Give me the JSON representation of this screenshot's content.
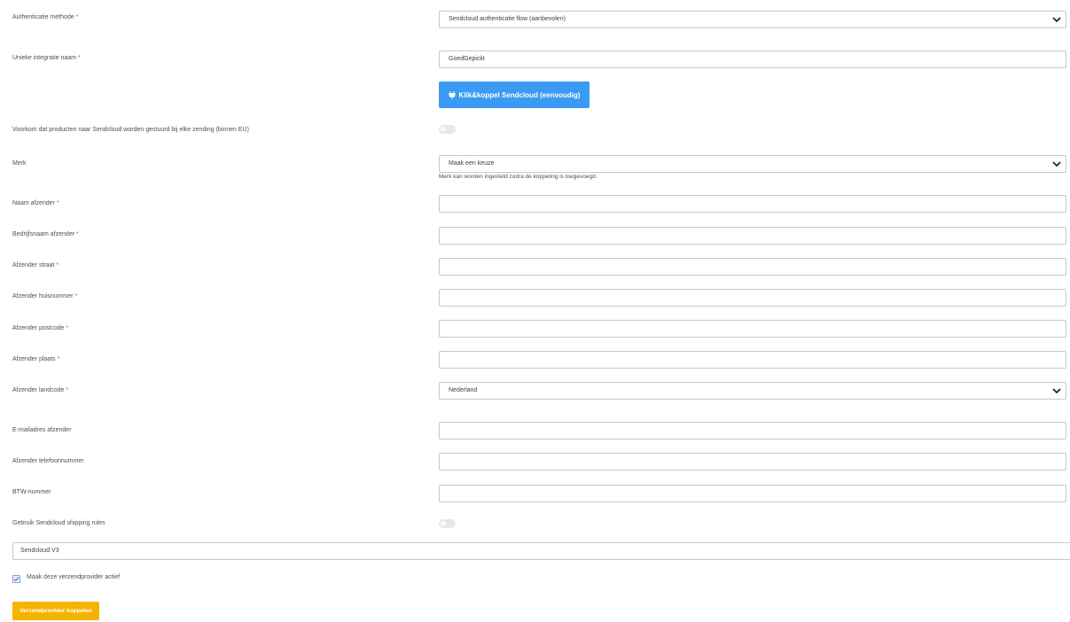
{
  "form": {
    "auth_method": {
      "label": "Authenticatie methode",
      "required": "*",
      "value": "Sendcloud authenticatie flow (aanbevolen)"
    },
    "integration_name": {
      "label": "Unieke integratie naam",
      "required": "*",
      "value": "GoedGepickt"
    },
    "connect_button": {
      "label": "Klik&koppel Sendcloud (eenvoudig)",
      "icon": "plug-icon"
    },
    "customs_toggle": {
      "label": "Voorkom dat producten naar Sendcloud worden gestuurd bij elke zending (binnen EU)",
      "on": false
    },
    "brand": {
      "label": "Merk",
      "value": "Maak een keuze",
      "helper": "Merk kan worden ingesteld zodra de koppeling is toegevoegd."
    },
    "sender_name": {
      "label": "Naam afzender",
      "required": "*",
      "value": ""
    },
    "sender_company": {
      "label": "Bedrijfsnaam afzender",
      "required": "*",
      "value": ""
    },
    "sender_street": {
      "label": "Afzender straat",
      "required": "*",
      "value": ""
    },
    "sender_house_number": {
      "label": "Afzender huisnummer",
      "required": "*",
      "value": ""
    },
    "sender_postcode": {
      "label": "Afzender postcode",
      "required": "*",
      "value": ""
    },
    "sender_city": {
      "label": "Afzender plaats",
      "required": "*",
      "value": ""
    },
    "sender_country": {
      "label": "Afzender landcode",
      "required": "*",
      "value": "Nederland"
    },
    "sender_email": {
      "label": "E-mailadres afzender",
      "value": ""
    },
    "sender_phone": {
      "label": "Afzender telefoonnummer",
      "value": ""
    },
    "vat_number": {
      "label": "BTW-nummer",
      "value": ""
    },
    "shipping_rules_toggle": {
      "label": "Gebruik Sendcloud shipping rules",
      "on": false
    }
  },
  "provider": {
    "name": "Sendcloud V3",
    "active_checkbox": {
      "label": "Maak deze verzendprovider actief",
      "checked": true
    },
    "submit_label": "Verzendprovider koppelen"
  },
  "colors": {
    "primary_blue": "#3b9af4",
    "accent_yellow": "#f5b400",
    "required_red": "#d9534f",
    "border": "#c4c8ce"
  }
}
